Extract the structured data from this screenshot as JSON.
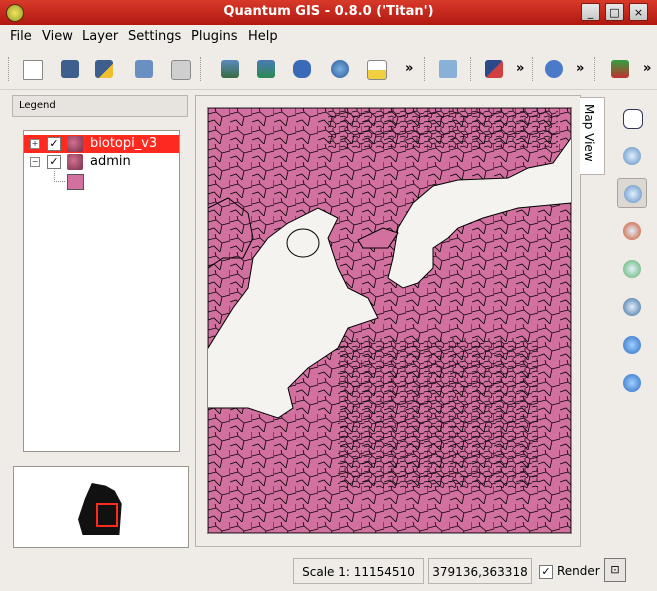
{
  "window": {
    "title": "Quantum GIS - 0.8.0 ('Titan')",
    "buttons": [
      "_",
      "□",
      "×"
    ]
  },
  "menu": [
    "File",
    "View",
    "Layer",
    "Settings",
    "Plugins",
    "Help"
  ],
  "toolbar": {
    "icons": [
      "new-project-icon",
      "save-project-icon",
      "save-as-icon",
      "open-project-icon",
      "print-icon",
      "add-raster-icon",
      "add-vector-icon",
      "add-postgis-icon",
      "add-wms-icon",
      "new-layer-icon",
      "capture-point-icon",
      "capture-line-icon",
      "identify-icon",
      "plugin-icon"
    ],
    "more": "»"
  },
  "legend": {
    "header": "Legend",
    "layers": [
      {
        "label": "biotopi_v3",
        "expander": "+",
        "checked": true,
        "selected": true
      },
      {
        "label": "admin",
        "expander": "−",
        "checked": true,
        "selected": false
      }
    ],
    "checkmark": "✓"
  },
  "map": {
    "tab_label": "Map View",
    "fill_color": "#d270a0",
    "water_color": "#f5f3ef",
    "border_color": "#000000"
  },
  "side_tools": [
    "pan-icon",
    "zoom-in-icon",
    "zoom-out-icon",
    "zoom-full-icon",
    "zoom-selection-icon",
    "zoom-layer-icon",
    "zoom-last-icon",
    "refresh-icon"
  ],
  "status": {
    "scale": "Scale 1: 11154510",
    "coords": "379136,363318",
    "render_label": "Render",
    "render_checked": true,
    "checkmark": "✓"
  },
  "colors": {
    "titlebar": "#c8281a",
    "selection": "#ff2a1f",
    "polygon": "#d270a0"
  }
}
